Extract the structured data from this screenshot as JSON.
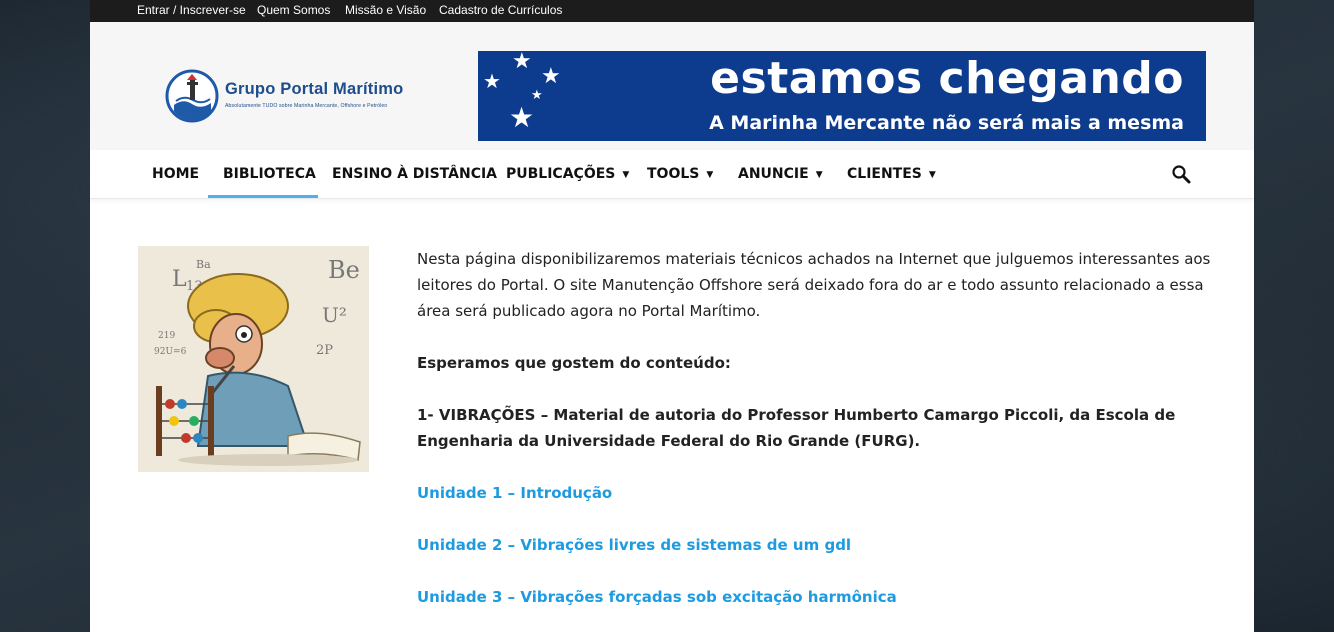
{
  "topbar": {
    "links": [
      "Entrar / Inscrever-se",
      "Quem Somos",
      "Missão e Visão",
      "Cadastro de Currículos"
    ]
  },
  "logo": {
    "title": "Grupo Portal Marítimo",
    "subtitle": "Absolutamente TUDO sobre Marinha Mercante, Offshore e Petróleo"
  },
  "banner": {
    "title": "estamos chegando",
    "subtitle": "A Marinha Mercante não será mais a mesma",
    "background": "#0d3b8e"
  },
  "nav": {
    "items": [
      "HOME",
      "BIBLIOTECA",
      "ENSINO À DISTÂNCIA",
      "PUBLICAÇÕES",
      "TOOLS",
      "ANUNCIE",
      "CLIENTES"
    ],
    "active": "BIBLIOTECA",
    "accent": "#4db2ec",
    "search_icon": "search-icon"
  },
  "content": {
    "intro": "Nesta página disponibilizaremos materiais técnicos achados na Internet que julguemos interessantes aos leitores do Portal. O site Manutenção Offshore será deixado fora do ar e todo assunto relacionado a essa área será publicado agora no Portal Marítimo.",
    "greeting": "Esperamos que gostem do conteúdo:",
    "section1": "1- VIBRAÇÕES – Material de autoria do Professor Humberto Camargo Piccoli, da Escola de Engenharia da Universidade Federal do Rio Grande (FURG).",
    "links": [
      "Unidade 1 – Introdução",
      "Unidade 2 – Vibrações livres de sistemas de um gdl",
      "Unidade 3 – Vibrações forçadas sob excitação harmônica"
    ],
    "link_color": "#1e9be0"
  }
}
